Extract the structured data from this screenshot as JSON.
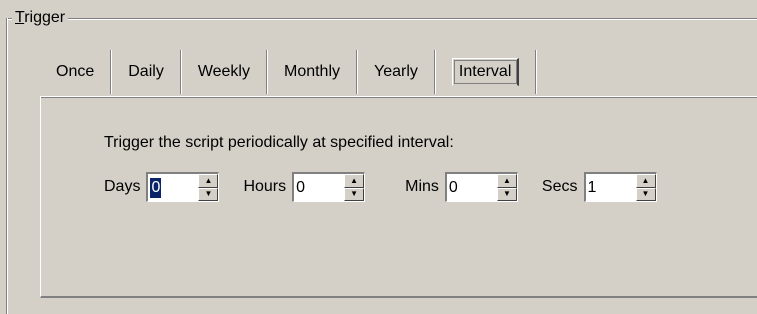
{
  "group": {
    "title_mnemonic": "T",
    "title_rest": "rigger"
  },
  "tabs": [
    {
      "label": "Once",
      "selected": false
    },
    {
      "label": "Daily",
      "selected": false
    },
    {
      "label": "Weekly",
      "selected": false
    },
    {
      "label": "Monthly",
      "selected": false
    },
    {
      "label": "Yearly",
      "selected": false
    },
    {
      "label": "Interval",
      "selected": true
    }
  ],
  "interval_panel": {
    "description": "Trigger the script periodically at specified interval:",
    "fields": {
      "days": {
        "label": "Days",
        "value": "0"
      },
      "hours": {
        "label": "Hours",
        "value": "0"
      },
      "mins": {
        "label": "Mins",
        "value": "0"
      },
      "secs": {
        "label": "Secs",
        "value": "1"
      }
    }
  },
  "icons": {
    "spin_up": "spin-up-arrow-icon",
    "spin_down": "spin-down-arrow-icon"
  },
  "colors": {
    "face": "#d4d0c8",
    "selection": "#0a246a",
    "shadow": "#808080",
    "highlight": "#ffffff"
  }
}
